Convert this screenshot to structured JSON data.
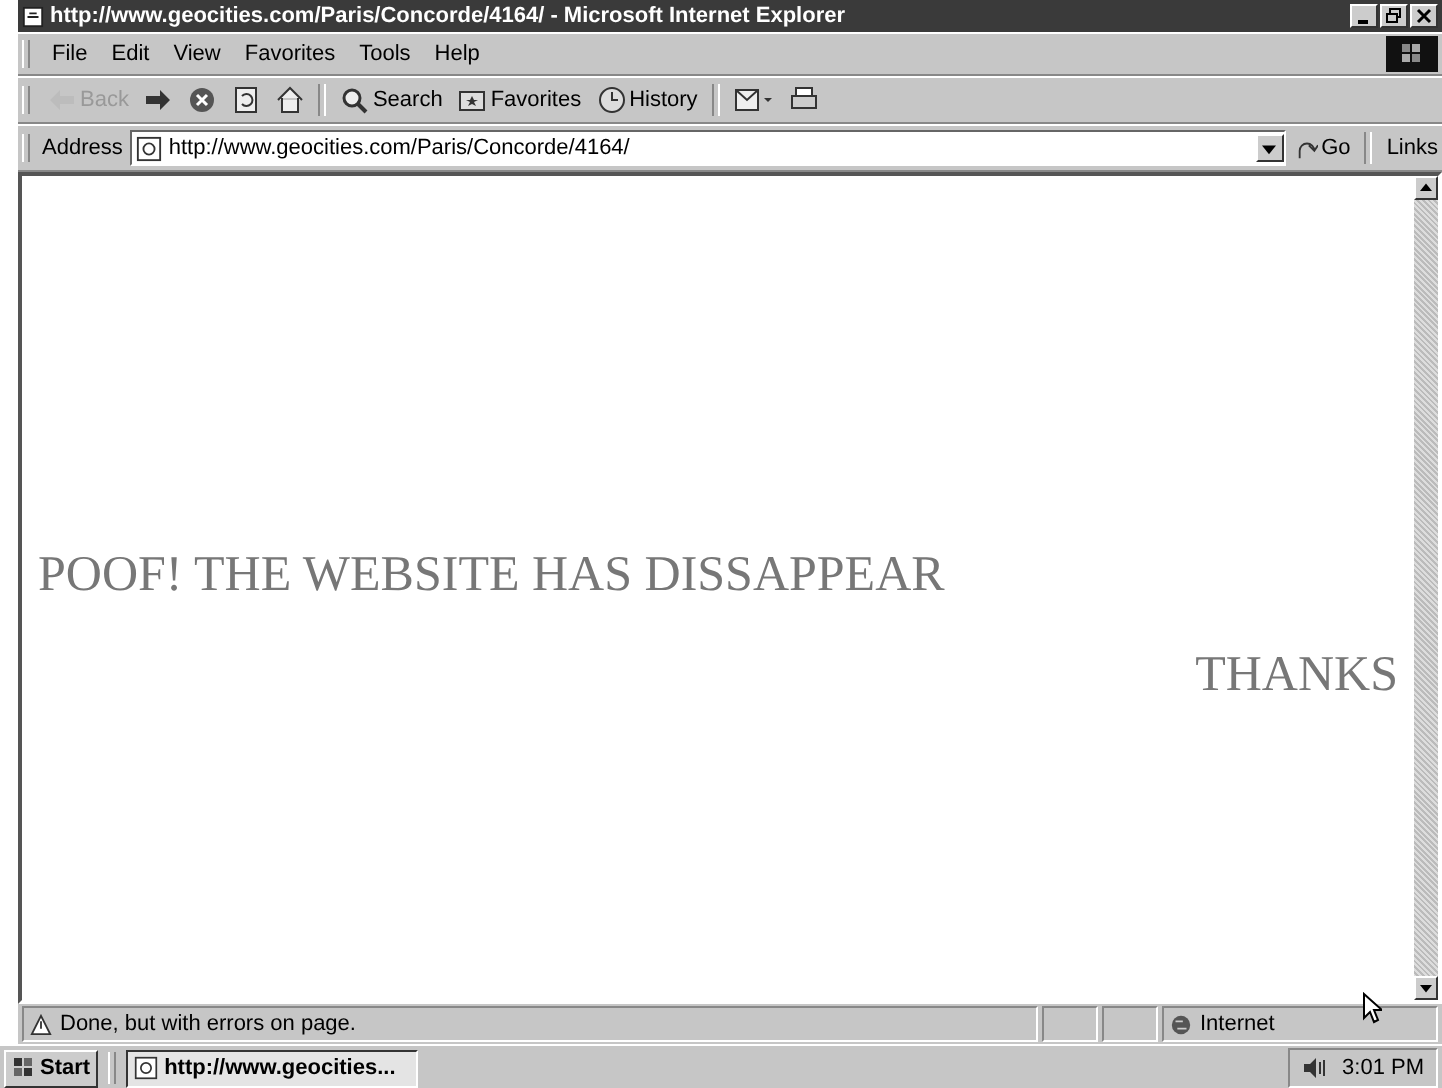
{
  "window": {
    "title": "http://www.geocities.com/Paris/Concorde/4164/ - Microsoft Internet Explorer"
  },
  "menu": [
    "File",
    "Edit",
    "View",
    "Favorites",
    "Tools",
    "Help"
  ],
  "toolbar": [
    {
      "kind": "back",
      "label": "Back",
      "disabled": true
    },
    {
      "kind": "forward",
      "disabled": false
    },
    {
      "kind": "stop",
      "disabled": false
    },
    {
      "kind": "refresh",
      "disabled": false
    },
    {
      "kind": "home",
      "disabled": false
    },
    {
      "kind": "search",
      "label": "Search",
      "disabled": false
    },
    {
      "kind": "favorites",
      "label": "Favorites",
      "disabled": false
    },
    {
      "kind": "history",
      "label": "History",
      "disabled": false
    },
    {
      "kind": "mail",
      "disabled": false
    },
    {
      "kind": "print",
      "disabled": false
    }
  ],
  "address_bar": {
    "label": "Address",
    "value": "http://www.geocities.com/Paris/Concorde/4164/",
    "go": "Go",
    "links": "Links"
  },
  "page": {
    "heading": "POOF! THE WEBSITE HAS DISSAPPEAR",
    "footer": "THANKS"
  },
  "status_bar": {
    "message": "Done, but with errors on page.",
    "zone": "Internet"
  },
  "taskbar": {
    "start": "Start",
    "task": "http://www.geocities...",
    "time": "3:01 PM"
  }
}
